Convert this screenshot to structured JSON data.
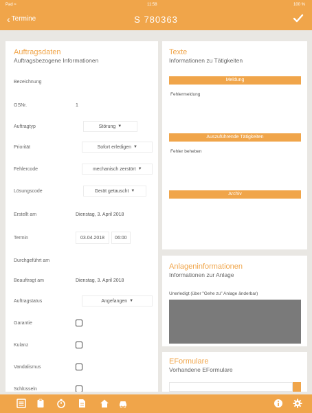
{
  "status": {
    "carrier": "Pad ≈",
    "time": "11:58",
    "battery": "100 %"
  },
  "nav": {
    "back_label": "Termine",
    "title": "S 780363"
  },
  "auftrag": {
    "title": "Auftragsdaten",
    "subtitle": "Auftragsbezogene Informationen",
    "bezeichnung_label": "Bezeichnung",
    "gsnr_label": "GSNr.",
    "gsnr_value": "1",
    "auftragtyp_label": "Auftragtyp",
    "auftragtyp_value": "Störung",
    "prioritaet_label": "Priorität",
    "prioritaet_value": "Sofort erledigen",
    "fehlercode_label": "Fehlercode",
    "fehlercode_value": "mechanisch zerstört",
    "loesungscode_label": "Lösungscode",
    "loesungscode_value": "Gerät getauscht",
    "erstellt_label": "Erstellt am",
    "erstellt_value": "Dienstag, 3. April 2018",
    "termin_label": "Termin",
    "termin_date": "03.04.2018",
    "termin_time": "06:00",
    "durchgefuehrt_label": "Durchgeführt am",
    "beauftragt_label": "Beauftragt am",
    "beauftragt_value": "Dienstag, 3. April 2018",
    "status_label": "Auftragstatus",
    "status_value": "Angefangen",
    "garantie_label": "Garantie",
    "kulanz_label": "Kulanz",
    "vandalismus_label": "Vandalismus",
    "next_label": "Schlüsseln"
  },
  "texte": {
    "title": "Texte",
    "subtitle": "Informationen zu Tätigkeiten",
    "meldung_button": "Meldung",
    "meldung_text": "Fehlermeldung",
    "taetigkeiten_button": "Auszuführende Tätigkeiten",
    "taetigkeiten_text": "Fehler beheben",
    "archiv_button": "Archiv"
  },
  "anlage": {
    "title": "Anlageninformationen",
    "subtitle": "Informationen zur Anlage",
    "note": "Unerledigt (über \"Gehe zu\" Anlage änderbar)"
  },
  "eformulare": {
    "title": "EFormulare",
    "subtitle": "Vorhandene EFormulare"
  },
  "colors": {
    "accent": "#f0a54a",
    "background": "#e9e7e3"
  },
  "tabbar": {
    "icons": [
      "list-icon",
      "clipboard-icon",
      "stopwatch-icon",
      "document-icon",
      "home-icon",
      "car-icon",
      "info-icon",
      "gear-icon"
    ]
  }
}
